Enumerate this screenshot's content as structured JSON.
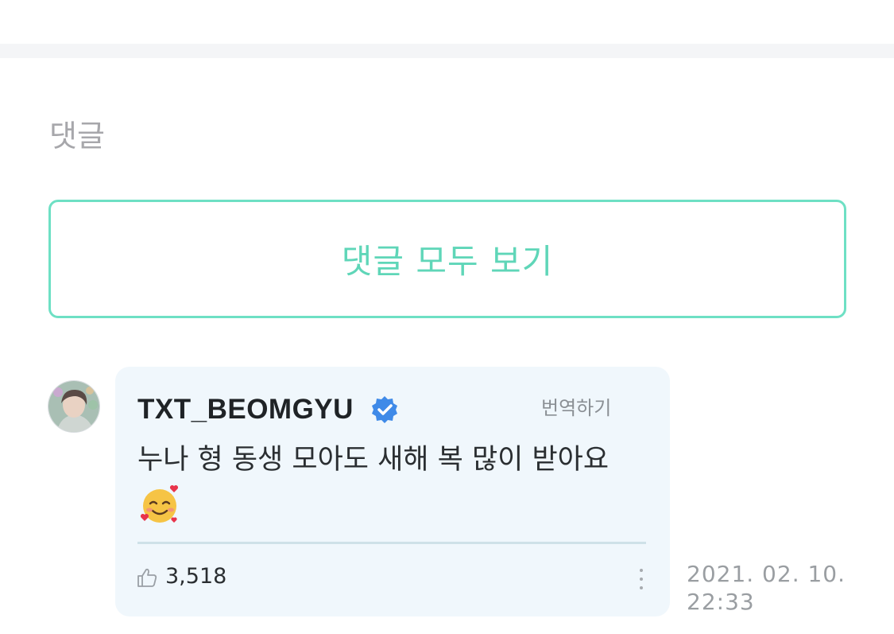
{
  "section": {
    "title": "댓글"
  },
  "view_all": {
    "label": "댓글 모두 보기"
  },
  "comment": {
    "author": "TXT_BEOMGYU",
    "verified": true,
    "translate_label": "번역하기",
    "text": "누나 형 동생 모아도 새해 복 많이 받아요",
    "emoji": "smiling-face-with-hearts",
    "like_count": "3,518",
    "date": "2021. 02. 10.",
    "time": "22:33"
  },
  "colors": {
    "accent": "#6ee0c4",
    "accent_text": "#5fd6b8",
    "bubble": "#f0f7fc",
    "verified": "#3f8ae8"
  }
}
